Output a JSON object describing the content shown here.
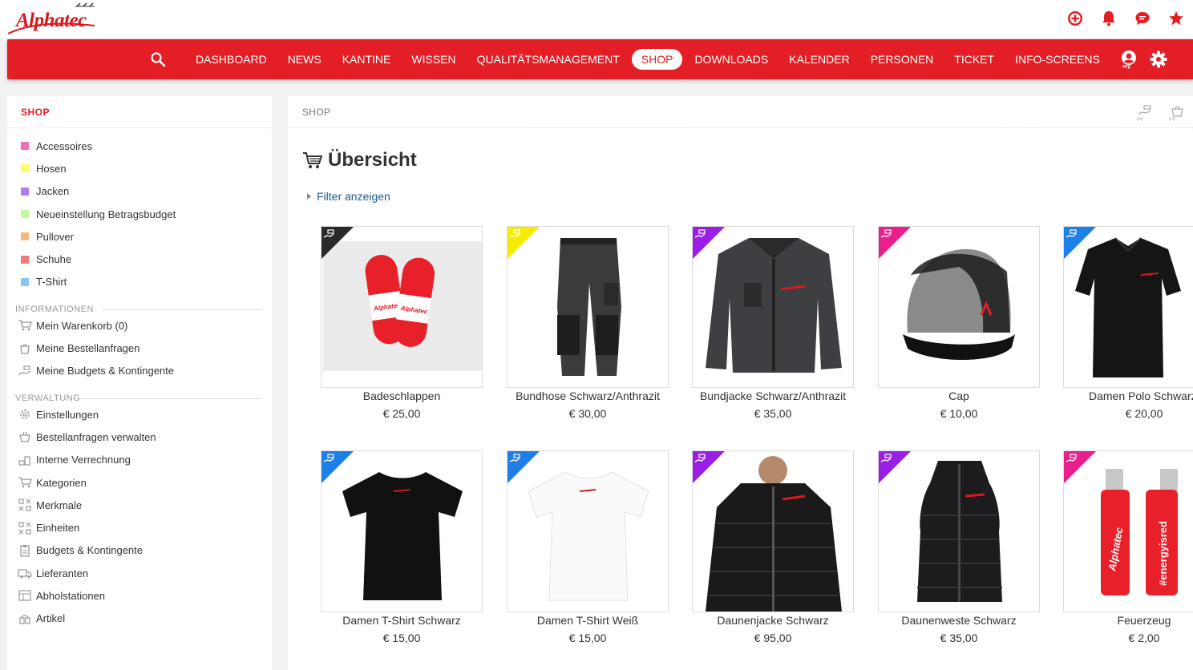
{
  "app": {
    "logo_text": "Alphatec"
  },
  "nav": {
    "items": [
      "DASHBOARD",
      "NEWS",
      "KANTINE",
      "WISSEN",
      "QUALITÄTSMANAGEMENT",
      "SHOP",
      "DOWNLOADS",
      "KALENDER",
      "PERSONEN",
      "TICKET",
      "INFO-SCREENS"
    ],
    "active": "SHOP"
  },
  "sidebar": {
    "title": "SHOP",
    "categories": [
      {
        "label": "Accessoires",
        "color": "#f06fb0"
      },
      {
        "label": "Hosen",
        "color": "#ffff66"
      },
      {
        "label": "Jacken",
        "color": "#b07ef0"
      },
      {
        "label": "Neueinstellung Betragsbudget",
        "color": "#c8f5a0"
      },
      {
        "label": "Pullover",
        "color": "#f8b880"
      },
      {
        "label": "Schuhe",
        "color": "#f27a7a"
      },
      {
        "label": "T-Shirt",
        "color": "#88c4f4"
      }
    ],
    "info_section": "INFORMATIONEN",
    "info_links": [
      "Mein Warenkorb (0)",
      "Meine Bestellanfragen",
      "Meine Budgets & Kontingente"
    ],
    "admin_section": "VERWALTUNG",
    "admin_links": [
      "Einstellungen",
      "Bestellanfragen verwalten",
      "Interne Verrechnung",
      "Kategorien",
      "Merkmale",
      "Einheiten",
      "Budgets & Kontingente",
      "Lieferanten",
      "Abholstationen",
      "Artikel"
    ]
  },
  "main": {
    "breadcrumb": "SHOP",
    "title": "Übersicht",
    "filter_label": "Filter anzeigen"
  },
  "products": [
    {
      "name": "Badeschlappen",
      "price": "€ 25,00",
      "corner": "#2a2a2a",
      "icon": "slippers"
    },
    {
      "name": "Bundhose Schwarz/Anthrazit",
      "price": "€ 30,00",
      "corner": "#f5ec00",
      "icon": "pants"
    },
    {
      "name": "Bundjacke Schwarz/Anthrazit",
      "price": "€ 35,00",
      "corner": "#9b1ee6",
      "icon": "workjacket"
    },
    {
      "name": "Cap",
      "price": "€ 10,00",
      "corner": "#ea1e8c",
      "icon": "cap"
    },
    {
      "name": "Damen Polo Schwarz",
      "price": "€ 20,00",
      "corner": "#1e7fe6",
      "icon": "polo"
    },
    {
      "name": "Damen T-Shirt Schwarz",
      "price": "€ 15,00",
      "corner": "#1e7fe6",
      "icon": "tshirt-black"
    },
    {
      "name": "Damen T-Shirt Weiß",
      "price": "€ 15,00",
      "corner": "#1e7fe6",
      "icon": "tshirt-white"
    },
    {
      "name": "Daunenjacke Schwarz",
      "price": "€ 95,00",
      "corner": "#9b1ee6",
      "icon": "downjacket"
    },
    {
      "name": "Daunenweste Schwarz",
      "price": "€ 35,00",
      "corner": "#9b1ee6",
      "icon": "vest"
    },
    {
      "name": "Feuerzeug",
      "price": "€ 2,00",
      "corner": "#ea1e8c",
      "icon": "lighter"
    }
  ]
}
